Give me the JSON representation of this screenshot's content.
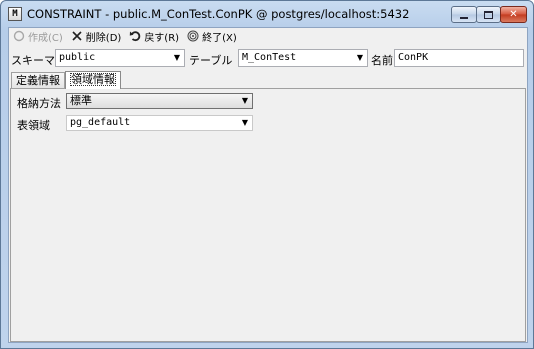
{
  "window": {
    "title": "CONSTRAINT - public.M_ConTest.ConPK @ postgres/localhost:5432",
    "app_icon_letter": "M",
    "controls": {
      "minimize": "minimize-icon",
      "maximize": "maximize-icon",
      "close": "✕"
    }
  },
  "toolbar": {
    "create_label": "作成(C)",
    "delete_label": "削除(D)",
    "revert_label": "戻す(R)",
    "finish_label": "終了(X)"
  },
  "fields": {
    "schema_label": "スキーマ",
    "schema_value": "public",
    "table_label": "テーブル",
    "table_value": "M_ConTest",
    "name_label": "名前",
    "name_value": "ConPK"
  },
  "tabs": [
    {
      "label": "定義情報",
      "active": false
    },
    {
      "label": "領域情報",
      "active": true
    }
  ],
  "storage": {
    "method_label": "格納方法",
    "method_value": "標準",
    "tablespace_label": "表領域",
    "tablespace_value": "pg_default"
  },
  "arrow_glyph": "▼"
}
